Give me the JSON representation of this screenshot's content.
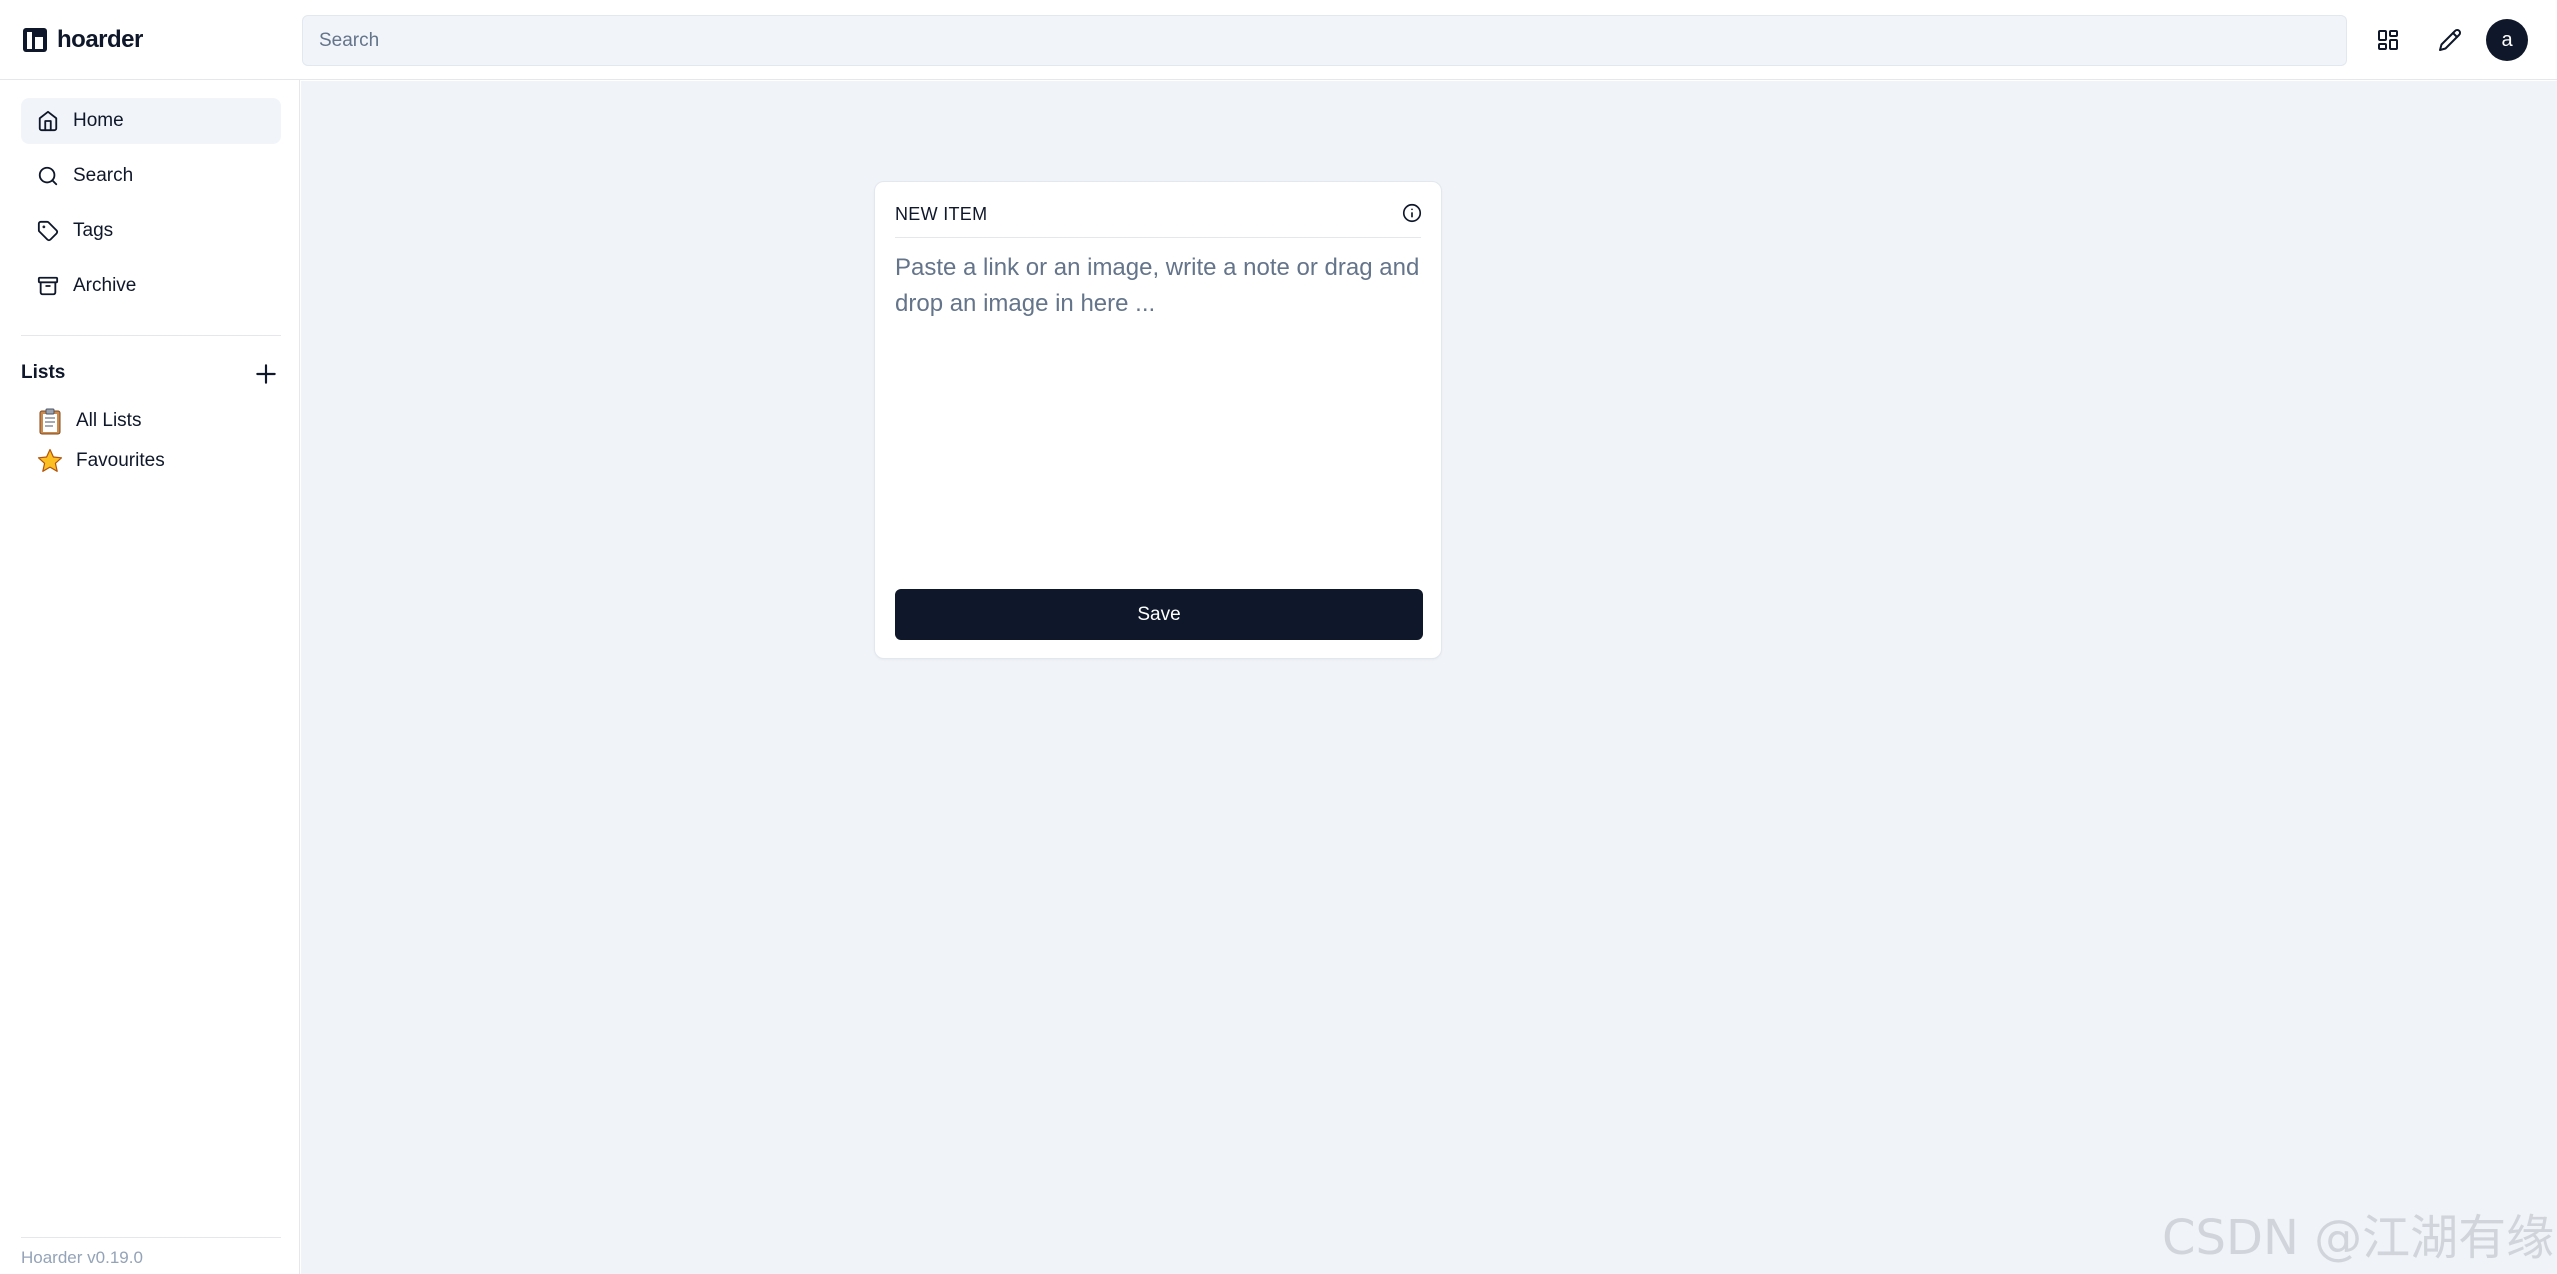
{
  "app": {
    "name": "hoarder",
    "version": "Hoarder v0.19.0"
  },
  "header": {
    "search_placeholder": "Search",
    "layout_icon": "layout-grid-icon",
    "edit_icon": "pencil-icon",
    "avatar_letter": "a"
  },
  "sidebar": {
    "nav": [
      {
        "label": "Home",
        "icon": "home-icon",
        "active": true
      },
      {
        "label": "Search",
        "icon": "search-icon",
        "active": false
      },
      {
        "label": "Tags",
        "icon": "tag-icon",
        "active": false
      },
      {
        "label": "Archive",
        "icon": "archive-icon",
        "active": false
      }
    ],
    "lists_heading": "Lists",
    "add_list_icon": "plus-icon",
    "lists": [
      {
        "label": "All Lists",
        "icon": "clipboard-emoji"
      },
      {
        "label": "Favourites",
        "icon": "star-emoji"
      }
    ]
  },
  "editor": {
    "title": "NEW ITEM",
    "info_icon": "info-icon",
    "placeholder": "Paste a link or an image, write a note or drag and drop an image in here ...",
    "save_label": "Save"
  },
  "watermark": "CSDN @江湖有缘",
  "colors": {
    "primary": "#0f172a",
    "main_background": "#f0f3f8",
    "muted_text": "#64748b",
    "active_nav": "#f1f5f9"
  }
}
